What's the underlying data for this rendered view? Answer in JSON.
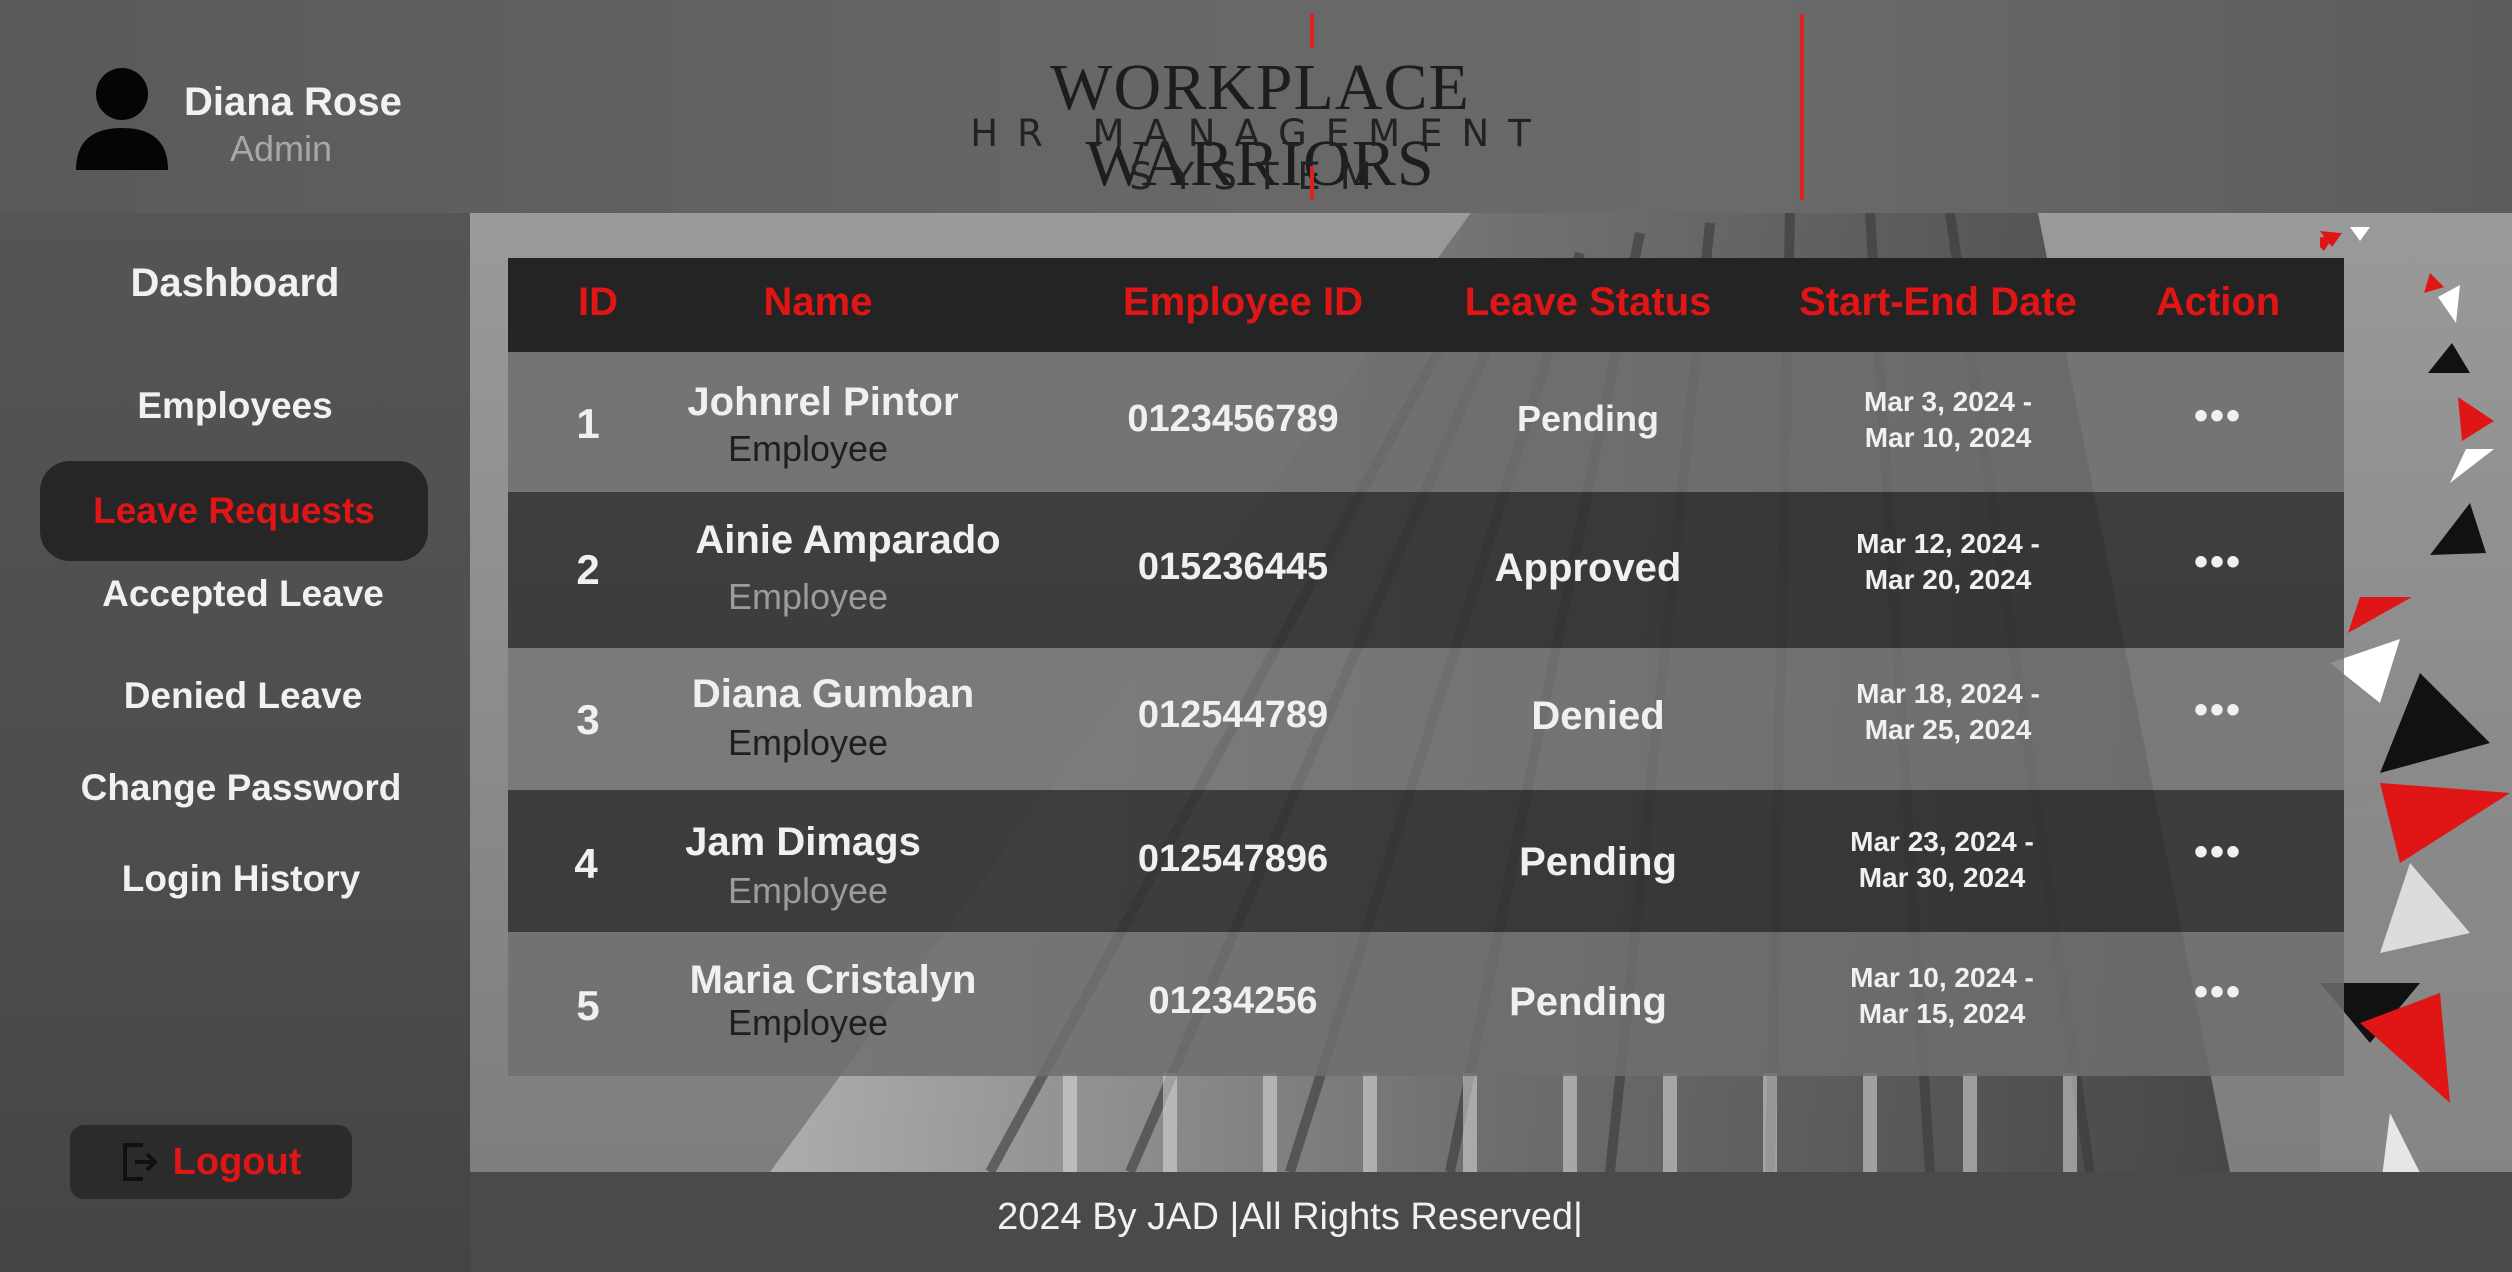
{
  "user": {
    "name": "Diana Rose",
    "role": "Admin"
  },
  "brand": {
    "title": "WORKPLACE WARRIORS",
    "subtitle": "HR MANAGEMENT SYSTEM"
  },
  "sidebar": {
    "items": [
      {
        "label": "Dashboard"
      },
      {
        "label": "Employees"
      },
      {
        "label": "Leave Requests",
        "active": true
      },
      {
        "label": "Accepted Leave"
      },
      {
        "label": "Denied Leave"
      },
      {
        "label": "Change Password"
      },
      {
        "label": "Login History"
      }
    ],
    "logout_label": "Logout"
  },
  "table": {
    "headers": [
      "ID",
      "Name",
      "Employee ID",
      "Leave Status",
      "Start-End Date",
      "Action"
    ],
    "rows": [
      {
        "id": "1",
        "name": "Johnrel Pintor",
        "role": "Employee",
        "employee_id": "0123456789",
        "status": "Pending",
        "date_start": "Mar 3, 2024 -",
        "date_end": "Mar 10, 2024",
        "action": "•••"
      },
      {
        "id": "2",
        "name": "Ainie Amparado",
        "role": "Employee",
        "employee_id": "015236445",
        "status": "Approved",
        "date_start": "Mar 12, 2024 -",
        "date_end": "Mar 20, 2024",
        "action": "•••"
      },
      {
        "id": "3",
        "name": "Diana Gumban",
        "role": "Employee",
        "employee_id": "012544789",
        "status": "Denied",
        "date_start": "Mar 18, 2024 -",
        "date_end": "Mar 25, 2024",
        "action": "•••"
      },
      {
        "id": "4",
        "name": "Jam Dimags",
        "role": "Employee",
        "employee_id": "012547896",
        "status": "Pending",
        "date_start": "Mar 23, 2024 -",
        "date_end": "Mar 30, 2024",
        "action": "•••"
      },
      {
        "id": "5",
        "name": "Maria Cristalyn",
        "role": "Employee",
        "employee_id": "01234256",
        "status": "Pending",
        "date_start": "Mar 10, 2024 -",
        "date_end": "Mar 15, 2024",
        "action": "•••"
      }
    ]
  },
  "footer": {
    "text": "2024 By JAD |All Rights Reserved|"
  },
  "colors": {
    "accent": "#e01515",
    "header_bg": "#242424",
    "row_dark": "#3a3a3a",
    "row_light": "#666666"
  }
}
